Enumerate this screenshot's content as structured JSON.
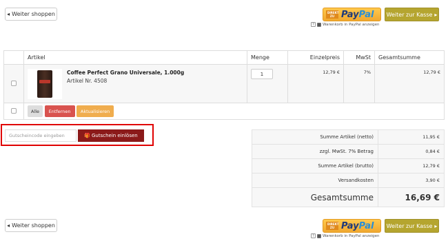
{
  "nav": {
    "continue_shopping": "Weiter shoppen",
    "checkout": "Weiter zur Kasse",
    "paypal_direkt": "DIREKT ZU",
    "paypal_pay": "Pay",
    "paypal_pal": "Pal",
    "paypal_note": "Warenkorb in PayPal anzeigen",
    "help_glyph": "?"
  },
  "cart": {
    "headers": {
      "article": "Artikel",
      "qty": "Menge",
      "unit_price": "Einzelpreis",
      "vat": "MwSt",
      "total": "Gesamtsumme"
    },
    "items": [
      {
        "name": "Coffee Perfect Grano Universale, 1.000g",
        "sku": "Artikel Nr. 4508",
        "qty": "1",
        "unit_price": "12,79 €",
        "vat": "7%",
        "total": "12,79 €"
      }
    ],
    "actions": {
      "all": "Alle",
      "remove": "Entfernen",
      "update": "Aktualisieren"
    }
  },
  "coupon": {
    "placeholder": "Gutscheincode eingeben",
    "redeem": "Gutschein einlösen"
  },
  "totals": {
    "rows": [
      {
        "label": "Summe Artikel (netto)",
        "value": "11,95 €"
      },
      {
        "label": "zzgl. MwSt. 7% Betrag",
        "value": "0,84 €"
      },
      {
        "label": "Summe Artikel (brutto)",
        "value": "12,79 €"
      },
      {
        "label": "Versandkosten",
        "value": "3,90 €"
      }
    ],
    "grand_label": "Gesamtsumme",
    "grand_value": "16,69 €"
  },
  "colors": {
    "olive": "#b5a52f",
    "danger": "#d9534f",
    "warning": "#f0ad4e",
    "coupon_red": "#8b1a1a",
    "highlight": "#e00000"
  }
}
